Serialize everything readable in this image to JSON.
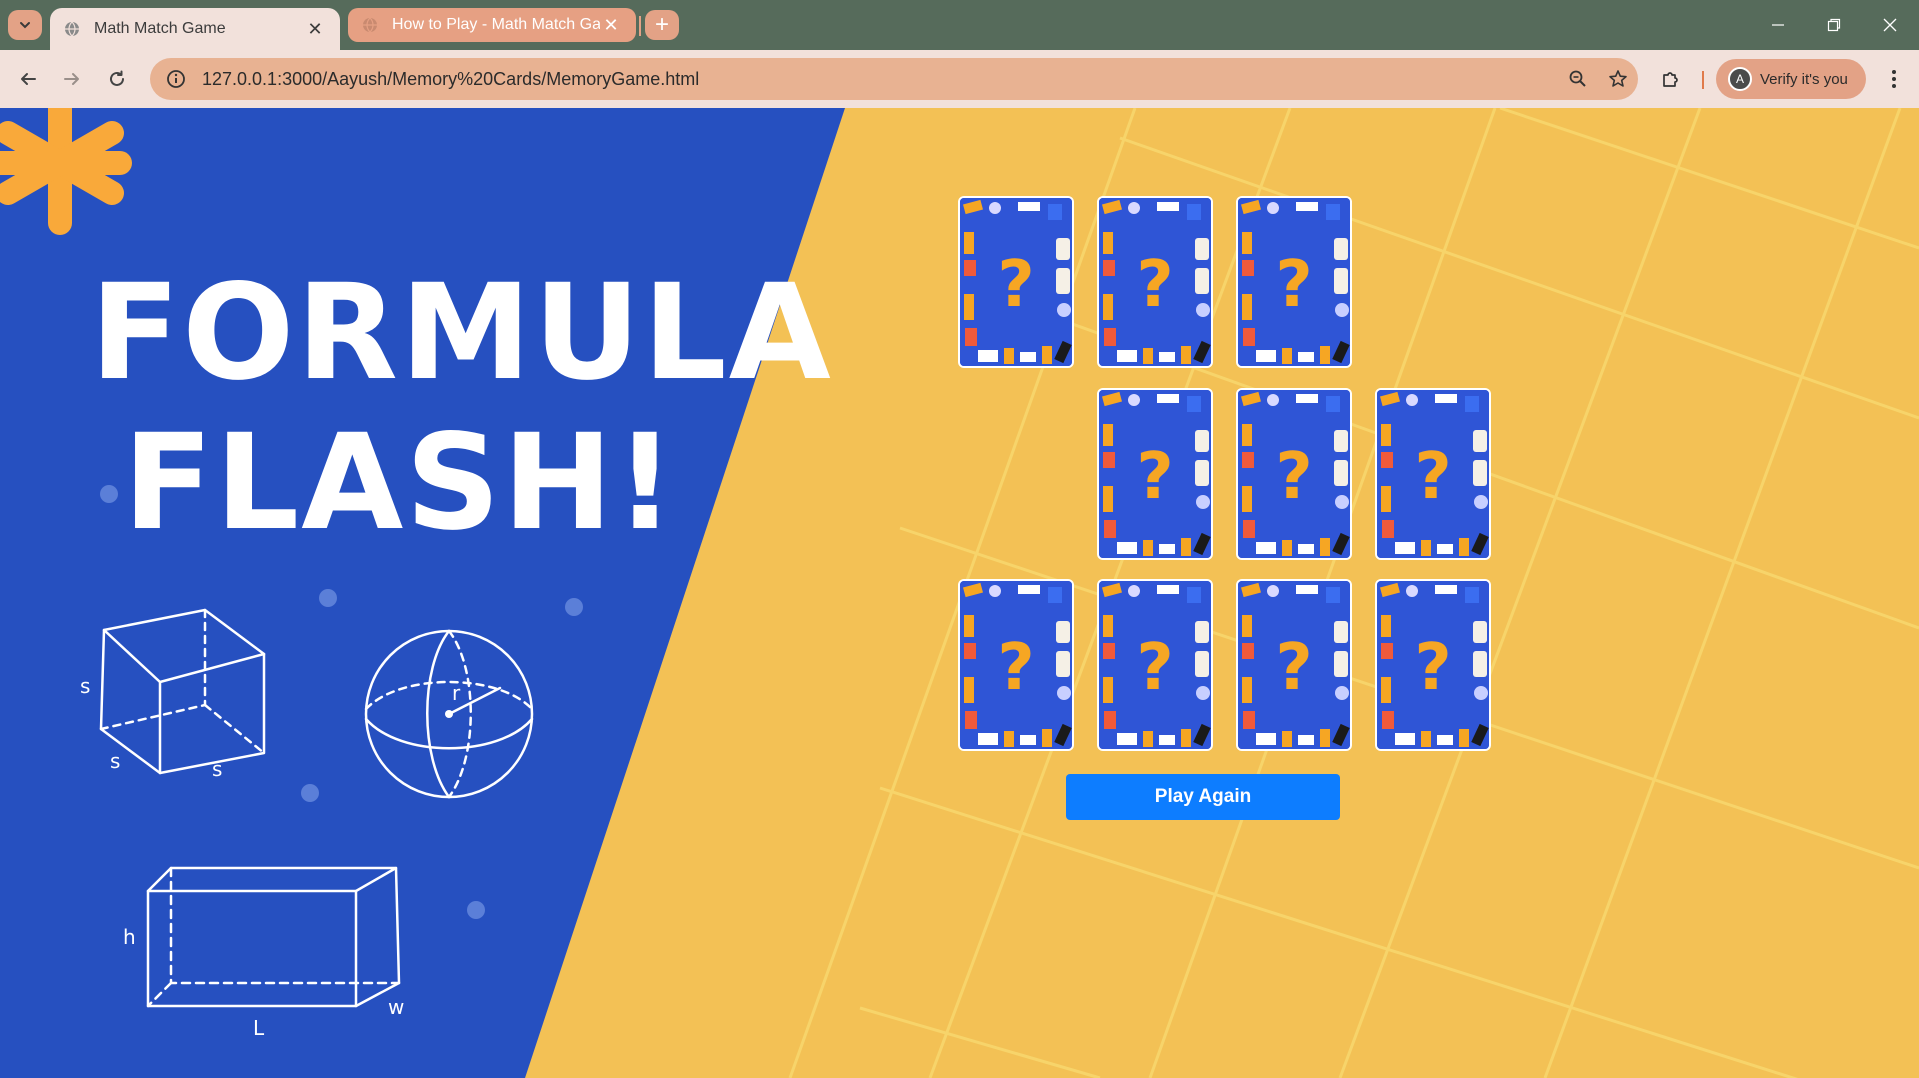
{
  "browser": {
    "tabs": [
      {
        "title": "Math Match Game",
        "active": true
      },
      {
        "title": "How to Play - Math Match Game",
        "active": false
      }
    ],
    "url": "127.0.0.1:3000/Aayush/Memory%20Cards/MemoryGame.html",
    "profile_button": "Verify it's you",
    "profile_initial": "A"
  },
  "game": {
    "title_line1": "FORMULA",
    "title_line2": "FLASH!",
    "card_back_symbol": "?",
    "cards": [
      {
        "state": "face-down"
      },
      {
        "state": "face-down"
      },
      {
        "state": "face-down"
      },
      {
        "state": "face-down"
      },
      {
        "state": "face-down"
      },
      {
        "state": "face-down"
      },
      {
        "state": "face-down"
      },
      {
        "state": "face-down"
      },
      {
        "state": "face-down"
      },
      {
        "state": "face-down"
      }
    ],
    "play_again_label": "Play Again"
  },
  "doodle_labels": {
    "cube": [
      "s",
      "s",
      "s"
    ],
    "sphere": [
      "r"
    ],
    "prism": [
      "h",
      "L",
      "w"
    ]
  },
  "colors": {
    "blue_panel": "#2650c0",
    "yellow_background": "#f3c155",
    "card_back": "#2f55d6",
    "question_mark": "#f6a623",
    "button": "#0d7dff",
    "starburst": "#f9a93a"
  }
}
